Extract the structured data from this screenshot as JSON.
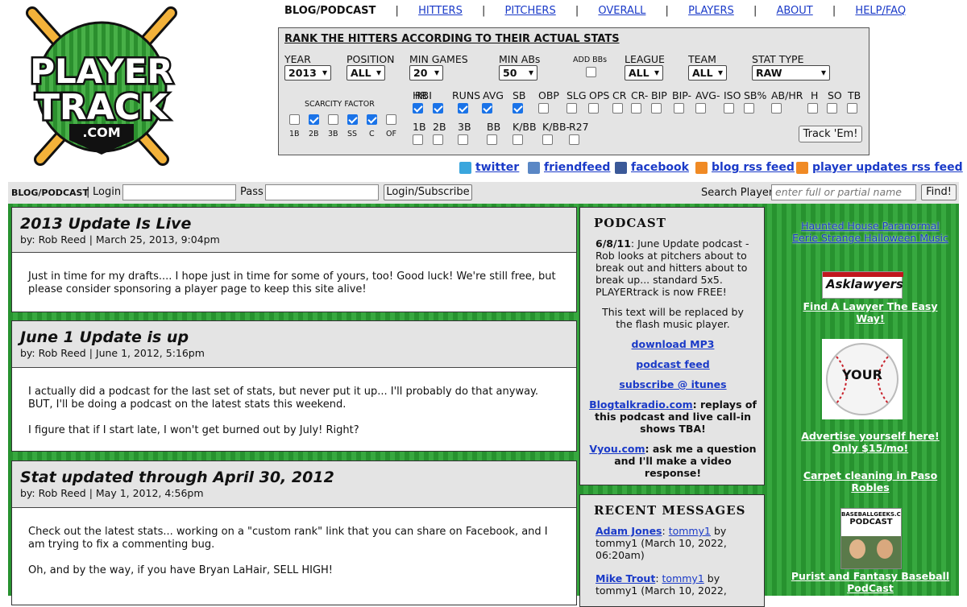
{
  "logo": {
    "line1": "PLAYER",
    "line2": "TRACK",
    "line3": ".COM"
  },
  "nav": {
    "current": "BLOG/PODCAST",
    "links": [
      "HITTERS",
      "PITCHERS",
      "OVERALL",
      "PLAYERS",
      "ABOUT",
      "HELP/FAQ"
    ],
    "sep": "|"
  },
  "ranker": {
    "title": "RANK THE HITTERS ACCORDING TO THEIR ACTUAL STATS",
    "year": {
      "label": "YEAR",
      "value": "2013"
    },
    "position": {
      "label": "POSITION",
      "value": "ALL"
    },
    "min_games": {
      "label": "MIN GAMES",
      "value": "20"
    },
    "min_abs": {
      "label": "MIN ABs",
      "value": "50"
    },
    "add_bbs": {
      "label": "ADD BBs",
      "checked": false
    },
    "league": {
      "label": "LEAGUE",
      "value": "ALL"
    },
    "team": {
      "label": "TEAM",
      "value": "ALL"
    },
    "stat_type": {
      "label": "STAT TYPE",
      "value": "RAW"
    },
    "scarcity": {
      "label": "SCARCITY FACTOR",
      "items": [
        {
          "label": "1B",
          "checked": false
        },
        {
          "label": "2B",
          "checked": true
        },
        {
          "label": "3B",
          "checked": false
        },
        {
          "label": "SS",
          "checked": true
        },
        {
          "label": "C",
          "checked": true
        },
        {
          "label": "OF",
          "checked": false
        }
      ]
    },
    "stats_row1": [
      {
        "label": "HR",
        "checked": true
      },
      {
        "label": "RBI",
        "checked": true
      },
      {
        "label": "RUNS",
        "checked": true
      },
      {
        "label": "AVG",
        "checked": true
      },
      {
        "label": "SB",
        "checked": true
      },
      {
        "label": "OBP",
        "checked": false
      },
      {
        "label": "SLG",
        "checked": false
      },
      {
        "label": "OPS",
        "checked": false
      },
      {
        "label": "CR",
        "checked": false
      },
      {
        "label": "CR-",
        "checked": false
      },
      {
        "label": "BIP",
        "checked": false
      },
      {
        "label": "BIP-",
        "checked": false
      },
      {
        "label": "AVG-",
        "checked": false
      },
      {
        "label": "ISO",
        "checked": false
      },
      {
        "label": "SB%",
        "checked": false
      },
      {
        "label": "AB/HR",
        "checked": false
      },
      {
        "label": "H",
        "checked": false
      },
      {
        "label": "SO",
        "checked": false
      },
      {
        "label": "TB",
        "checked": false
      }
    ],
    "stats_row2": [
      {
        "label": "1B",
        "checked": false
      },
      {
        "label": "2B",
        "checked": false
      },
      {
        "label": "3B",
        "checked": false
      },
      {
        "label": "BB",
        "checked": false
      },
      {
        "label": "K/BB",
        "checked": false
      },
      {
        "label": "K/BB-",
        "checked": false
      },
      {
        "label": "R27",
        "checked": false
      }
    ],
    "submit_label": "Track 'Em!"
  },
  "social": [
    {
      "label": "twitter",
      "icon": "twitter-icon",
      "color": "#3aa6dd"
    },
    {
      "label": "friendfeed",
      "icon": "friendfeed-icon",
      "color": "#5a87c5"
    },
    {
      "label": "facebook",
      "icon": "facebook-icon",
      "color": "#3b5998"
    },
    {
      "label": "blog rss feed",
      "icon": "rss-icon",
      "color": "#f08a24"
    },
    {
      "label": "player updates rss feed",
      "icon": "rss-icon",
      "color": "#f08a24"
    }
  ],
  "loginbar": {
    "blog": "BLOG/PODCAST",
    "sep": "|",
    "login_label": "Login",
    "login_value": "",
    "pass_label": "Pass",
    "pass_value": "",
    "submit": "Login/Subscribe",
    "search_label": "Search Player",
    "search_placeholder": "enter full or partial name",
    "find": "Find!"
  },
  "posts": [
    {
      "title": "2013 Update Is Live",
      "byline": "by: Rob Reed | March 25, 2013, 9:04pm",
      "paragraphs": [
        "Just in time for my drafts.... I hope just in time for some of yours, too! Good luck! We're still free, but please consider sponsoring a player page to keep this site alive!"
      ]
    },
    {
      "title": "June 1 Update is up",
      "byline": "by: Rob Reed | June 1, 2012, 5:16pm",
      "paragraphs": [
        "I actually did a podcast for the last set of stats, but never put it up... I'll probably do that anyway. BUT, I'll be doing a podcast on the latest stats this weekend.",
        "I figure that if I start late, I won't get burned out by July! Right?"
      ]
    },
    {
      "title": "Stat updated through April 30, 2012",
      "byline": "by: Rob Reed | May 1, 2012, 4:56pm",
      "paragraphs": [
        "Check out the latest stats... working on a \"custom rank\" link that you can share on Facebook, and I am trying to fix a commenting bug.",
        "Oh, and by the way, if you have Bryan LaHair, SELL HIGH!"
      ]
    }
  ],
  "podcast": {
    "title": "PODCAST",
    "date": "6/8/11",
    "intro": ": June Update podcast - Rob looks at pitchers about to break out and hitters about to break up... standard 5x5. PLAYERtrack is now FREE!",
    "placeholder": "This text will be replaced by the flash music player.",
    "download": "download MP3",
    "feed": "podcast feed",
    "itunes": "subscribe @ itunes",
    "blogtalk_link": "Blogtalkradio.com",
    "blogtalk_text": ": replays of this podcast and live call-in shows TBA!",
    "vyou_link": "Vyou.com",
    "vyou_text": ": ask me a question and I'll make a video response!"
  },
  "recent": {
    "title": "RECENT MESSAGES",
    "messages": [
      {
        "player": "Adam Jones",
        "sep": ":",
        "user": "tommy1",
        "by": " by tommy1 (March 10, 2022, 06:20am)"
      },
      {
        "player": "Mike Trout",
        "sep": ":",
        "user": "tommy1",
        "by": " by tommy1 (March 10, 2022,"
      }
    ]
  },
  "ads": {
    "haunted": "Haunted House Paranormal Eerie Strange Halloween Music",
    "asklawyers_logo": "Asklawyers",
    "lawyer": "Find A Lawyer The Easy Way!",
    "ball_text": "YOUR",
    "advertise": "Advertise yourself here! Only $15/mo!",
    "carpet": "Carpet cleaning in Paso Robles",
    "bbg_logo": "BASEBALLGEEKS.COM",
    "bbg_sub": "PODCAST",
    "bbg": "Purist and Fantasy Baseball PodCast"
  }
}
